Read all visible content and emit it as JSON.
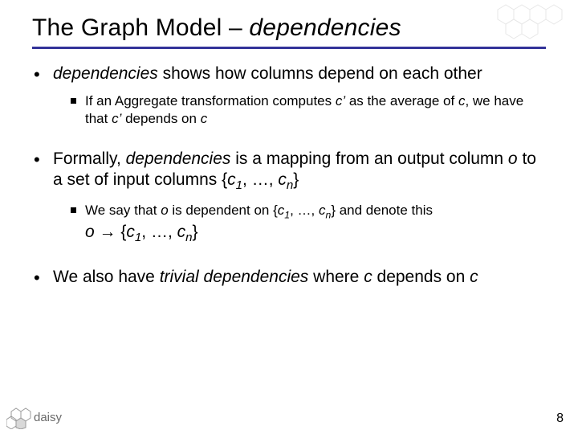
{
  "title": {
    "prefix": "The Graph Model – ",
    "emph": "dependencies"
  },
  "bullets": {
    "b1": {
      "pre": "",
      "emph": "dependencies",
      "post": " shows how columns depend on each other",
      "sub": {
        "s1_a": "If an Aggregate transformation computes ",
        "s1_b": "c’",
        "s1_c": " as the average of ",
        "s1_d": "c",
        "s1_e": ", we have that ",
        "s1_f": "c’",
        "s1_g": " depends on ",
        "s1_h": "c"
      }
    },
    "b2": {
      "a": "Formally, ",
      "b": "dependencies",
      "c": " is a mapping from an output column ",
      "d": "o",
      "e": " to a set of input columns {",
      "f": "c",
      "g": "1",
      "h": ", …, ",
      "i": "c",
      "j": "n",
      "k": "}",
      "sub": {
        "a": "We say that ",
        "b": "o",
        "c": " is dependent on {",
        "d": "c",
        "e": "1",
        "f": ", …, ",
        "g": "c",
        "h": "n",
        "i": "} and denote this",
        "j": "o",
        "arrow": " → ",
        "k": "{",
        "l": "c",
        "m": "1",
        "n": ", …, ",
        "o_": "c",
        "p": "n",
        "q": "}"
      }
    },
    "b3": {
      "a": "We also have ",
      "b": "trivial dependencies",
      "c": " where ",
      "d": "c",
      "e": " depends on ",
      "f": "c"
    }
  },
  "footer": {
    "logo_text": "daisy",
    "page": "8"
  }
}
